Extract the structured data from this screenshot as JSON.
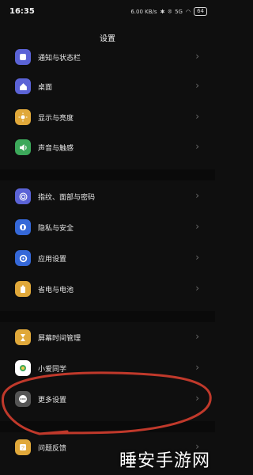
{
  "status_bar": {
    "time": "16:35",
    "net_speed": "6.00 KB/s",
    "signal": "5G",
    "battery": "64"
  },
  "header": {
    "title": "设置"
  },
  "settings": [
    {
      "label": "通知与状态栏",
      "icon": "notification-icon",
      "color": "#5b63d6"
    },
    {
      "label": "桌面",
      "icon": "home-icon",
      "color": "#5b63d6"
    },
    {
      "label": "显示与亮度",
      "icon": "sun-icon",
      "color": "#e0a83a"
    },
    {
      "label": "声音与触感",
      "icon": "volume-icon",
      "color": "#3ca85a"
    },
    {
      "label": "指纹、面部与密码",
      "icon": "fingerprint-icon",
      "color": "#5b63d6"
    },
    {
      "label": "隐私与安全",
      "icon": "privacy-icon",
      "color": "#3568d8"
    },
    {
      "label": "应用设置",
      "icon": "app-settings-icon",
      "color": "#3568d8"
    },
    {
      "label": "省电与电池",
      "icon": "battery-icon",
      "color": "#e0a83a"
    },
    {
      "label": "屏幕时间管理",
      "icon": "hourglass-icon",
      "color": "#e0a83a"
    },
    {
      "label": "小爱同学",
      "icon": "assistant-icon",
      "color": "#ffffff"
    },
    {
      "label": "更多设置",
      "icon": "more-icon",
      "color": "#555555"
    },
    {
      "label": "问题反馈",
      "icon": "feedback-icon",
      "color": "#e0a83a"
    }
  ],
  "watermark": "睡安手游网",
  "colors": {
    "background": "#0f0f0f",
    "annotation": "#c0392b"
  }
}
